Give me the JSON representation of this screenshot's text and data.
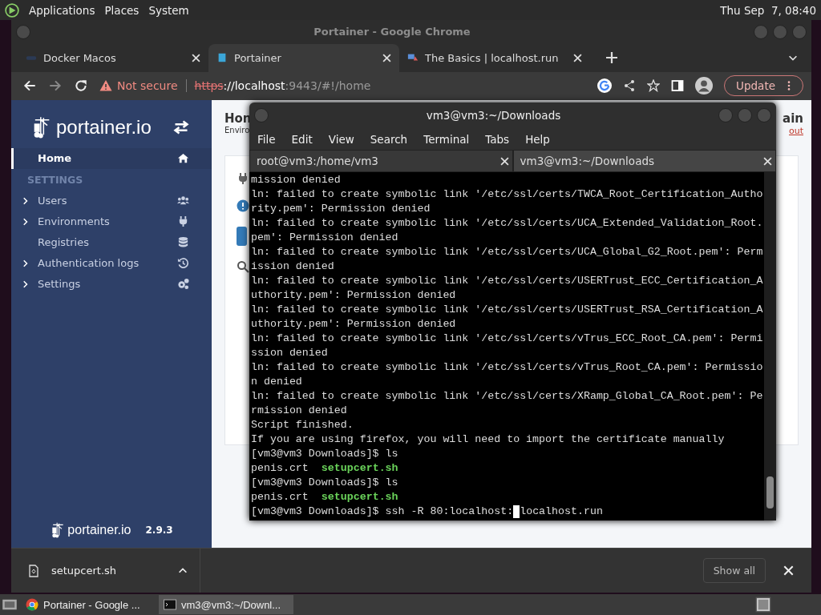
{
  "top_panel": {
    "menus": [
      "Applications",
      "Places",
      "System"
    ],
    "clock": "Thu Sep  7, 08:40"
  },
  "browser": {
    "title": "Portainer - Google Chrome",
    "tabs": [
      {
        "label": "Docker Macos",
        "selected": false
      },
      {
        "label": "Portainer",
        "selected": true
      },
      {
        "label": "The Basics | localhost.run",
        "selected": false
      }
    ],
    "address": {
      "security": "Not secure",
      "scheme": "https",
      "host": "://localhost",
      "path": ":9443/#!/home"
    },
    "update_button": "Update",
    "sidebar": {
      "logo": "portainer.io",
      "section": "SETTINGS",
      "items": [
        {
          "label": "Home",
          "selected": true,
          "expandable": false,
          "kind": "home"
        },
        {
          "label": "Users",
          "selected": false,
          "expandable": true,
          "kind": "users"
        },
        {
          "label": "Environments",
          "selected": false,
          "expandable": true,
          "kind": "plug"
        },
        {
          "label": "Registries",
          "selected": false,
          "expandable": false,
          "kind": "database"
        },
        {
          "label": "Authentication logs",
          "selected": false,
          "expandable": true,
          "kind": "history"
        },
        {
          "label": "Settings",
          "selected": false,
          "expandable": true,
          "kind": "gears"
        }
      ],
      "footer_logo": "portainer.io",
      "version": "2.9.3"
    },
    "page": {
      "heading": "Hon",
      "subheading": "Enviro",
      "user": "ain",
      "logout": "out"
    },
    "downloads": {
      "file": "setupcert.sh",
      "show_all": "Show all"
    }
  },
  "terminal": {
    "title": "vm3@vm3:~/Downloads",
    "menus": [
      "File",
      "Edit",
      "View",
      "Search",
      "Terminal",
      "Tabs",
      "Help"
    ],
    "tabs": [
      {
        "label": "root@vm3:/home/vm3",
        "selected": false
      },
      {
        "label": "vm3@vm3:~/Downloads",
        "selected": true
      }
    ],
    "lines": [
      {
        "kind": "text",
        "text": "mission denied"
      },
      {
        "kind": "text",
        "text": "ln: failed to create symbolic link '/etc/ssl/certs/TWCA_Root_Certification_Autho"
      },
      {
        "kind": "text",
        "text": "rity.pem': Permission denied"
      },
      {
        "kind": "text",
        "text": "ln: failed to create symbolic link '/etc/ssl/certs/UCA_Extended_Validation_Root."
      },
      {
        "kind": "text",
        "text": "pem': Permission denied"
      },
      {
        "kind": "text",
        "text": "ln: failed to create symbolic link '/etc/ssl/certs/UCA_Global_G2_Root.pem': Perm"
      },
      {
        "kind": "text",
        "text": "ission denied"
      },
      {
        "kind": "text",
        "text": "ln: failed to create symbolic link '/etc/ssl/certs/USERTrust_ECC_Certification_A"
      },
      {
        "kind": "text",
        "text": "uthority.pem': Permission denied"
      },
      {
        "kind": "text",
        "text": "ln: failed to create symbolic link '/etc/ssl/certs/USERTrust_RSA_Certification_A"
      },
      {
        "kind": "text",
        "text": "uthority.pem': Permission denied"
      },
      {
        "kind": "text",
        "text": "ln: failed to create symbolic link '/etc/ssl/certs/vTrus_ECC_Root_CA.pem': Permi"
      },
      {
        "kind": "text",
        "text": "ssion denied"
      },
      {
        "kind": "text",
        "text": "ln: failed to create symbolic link '/etc/ssl/certs/vTrus_Root_CA.pem': Permissio"
      },
      {
        "kind": "text",
        "text": "n denied"
      },
      {
        "kind": "text",
        "text": "ln: failed to create symbolic link '/etc/ssl/certs/XRamp_Global_CA_Root.pem': Pe"
      },
      {
        "kind": "text",
        "text": "rmission denied"
      },
      {
        "kind": "text",
        "text": "Script finished."
      },
      {
        "kind": "text",
        "text": "If you are using firefox, you will need to import the certificate manually"
      },
      {
        "kind": "text",
        "text": "[vm3@vm3 Downloads]$ ls"
      },
      {
        "kind": "listing",
        "files": [
          {
            "name": "penis.crt",
            "executable": false
          },
          {
            "name": "setupcert.sh",
            "executable": true
          }
        ]
      },
      {
        "kind": "text",
        "text": "[vm3@vm3 Downloads]$ ls"
      },
      {
        "kind": "listing",
        "files": [
          {
            "name": "penis.crt",
            "executable": false
          },
          {
            "name": "setupcert.sh",
            "executable": true
          }
        ]
      },
      {
        "kind": "input",
        "before_cursor": "[vm3@vm3 Downloads]$ ssh -R 80:localhost:",
        "after_cursor": "localhost.run"
      }
    ]
  },
  "taskbar": {
    "items": [
      {
        "label": "Portainer - Google ...",
        "selected": false,
        "kind": "browser"
      },
      {
        "label": "vm3@vm3:~/Downl...",
        "selected": true,
        "kind": "terminal"
      }
    ]
  }
}
